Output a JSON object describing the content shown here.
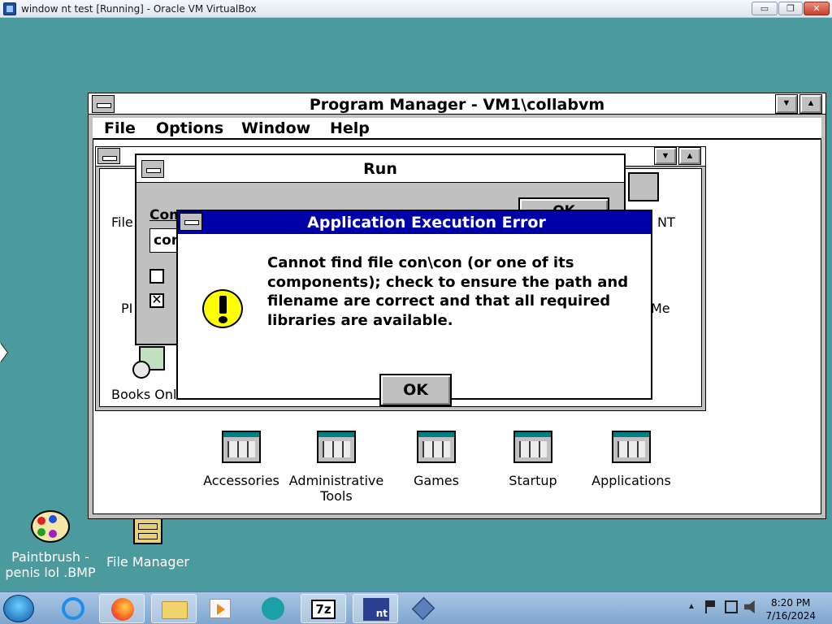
{
  "host": {
    "window_title": "window nt test [Running] - Oracle VM VirtualBox",
    "min_glyph": "▭",
    "restore_glyph": "❐",
    "close_glyph": "✕"
  },
  "progman": {
    "title": "Program Manager - VM1\\collabvm",
    "menu": [
      {
        "label": "File"
      },
      {
        "label": "Options"
      },
      {
        "label": "Window"
      },
      {
        "label": "Help"
      }
    ],
    "min_glyph": "▼",
    "max_glyph": "▲",
    "groups": [
      {
        "label": "Accessories"
      },
      {
        "label": "Administrative Tools"
      },
      {
        "label": "Games"
      },
      {
        "label": "Startup"
      },
      {
        "label": "Applications"
      }
    ]
  },
  "main_child": {
    "partial_labels": [
      "File",
      "PI",
      "Books Onli",
      "NT",
      "Me"
    ]
  },
  "run_dialog": {
    "title": "Run",
    "command_label_partial": "Com",
    "command_value_partial": "con",
    "ok_partial": "OK"
  },
  "error_dialog": {
    "title": "Application Execution Error",
    "message": "Cannot find file con\\con (or one of its components); check to ensure the path and filename are correct and that all required libraries are available.",
    "ok_label": "OK"
  },
  "desktop": {
    "paintbrush_label": "Paintbrush - penis lol .BMP",
    "file_manager_label": "File Manager"
  },
  "taskbar": {
    "clock_time": "8:20 PM",
    "clock_date": "7/16/2024",
    "tray_up_arrow": "▲",
    "apps": [
      {
        "name": "internet-explorer"
      },
      {
        "name": "firefox"
      },
      {
        "name": "file-explorer"
      },
      {
        "name": "media-player"
      },
      {
        "name": "teamviewer"
      },
      {
        "name": "7zip",
        "label": "7z"
      },
      {
        "name": "windows-nt",
        "label": "nt"
      },
      {
        "name": "virtualbox"
      }
    ]
  }
}
